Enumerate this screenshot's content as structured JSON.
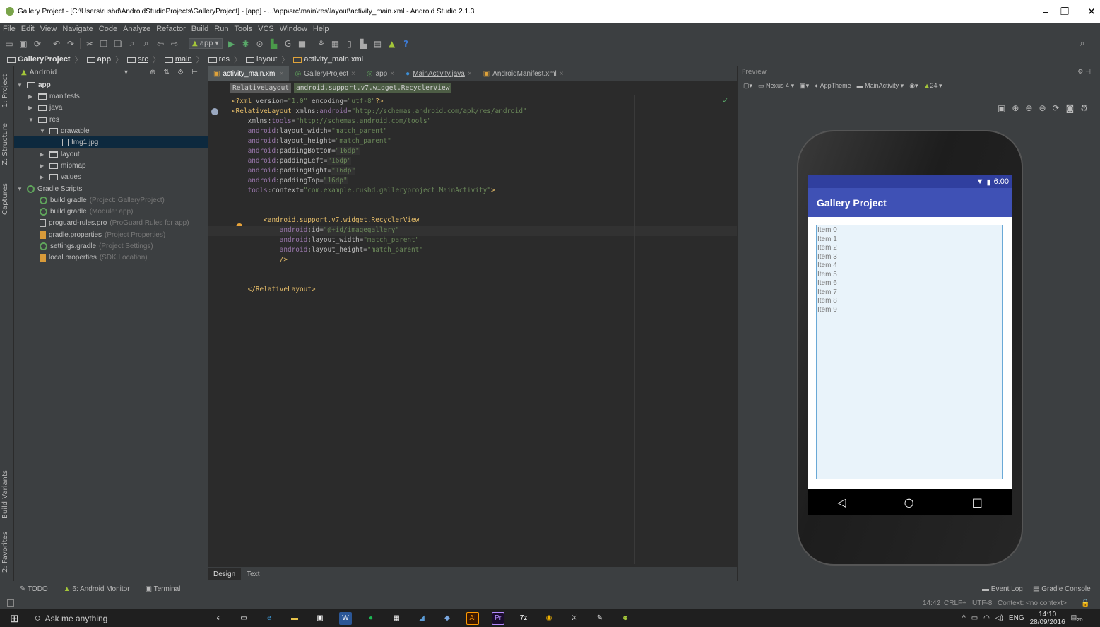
{
  "window": {
    "title": "Gallery Project - [C:\\Users\\rushd\\AndroidStudioProjects\\GalleryProject] - [app] - ...\\app\\src\\main\\res\\layout\\activity_main.xml - Android Studio 2.1.3",
    "min": "–",
    "max": "❐",
    "close": "✕"
  },
  "menu": [
    "File",
    "Edit",
    "View",
    "Navigate",
    "Code",
    "Analyze",
    "Refactor",
    "Build",
    "Run",
    "Tools",
    "VCS",
    "Window",
    "Help"
  ],
  "toolbar": {
    "config": "app",
    "help": "?"
  },
  "breadcrumb": [
    "GalleryProject",
    "app",
    "src",
    "main",
    "res",
    "layout",
    "activity_main.xml"
  ],
  "left_strip": {
    "project": "1: Project",
    "structure": "Z: Structure",
    "captures": "Captures",
    "build_variants": "Build Variants",
    "favorites": "2: Favorites"
  },
  "project_panel": {
    "view": "Android"
  },
  "tree": {
    "app": "app",
    "manifests": "manifests",
    "java": "java",
    "res": "res",
    "drawable": "drawable",
    "img": "Img1.jpg",
    "layout": "layout",
    "mipmap": "mipmap",
    "values": "values",
    "gradle_scripts": "Gradle Scripts",
    "files": [
      {
        "name": "build.gradle",
        "note": "(Project: GalleryProject)"
      },
      {
        "name": "build.gradle",
        "note": "(Module: app)"
      },
      {
        "name": "proguard-rules.pro",
        "note": "(ProGuard Rules for app)"
      },
      {
        "name": "gradle.properties",
        "note": "(Project Properties)"
      },
      {
        "name": "settings.gradle",
        "note": "(Project Settings)"
      },
      {
        "name": "local.properties",
        "note": "(SDK Location)"
      }
    ]
  },
  "editor_tabs": [
    {
      "label": "activity_main.xml",
      "close": "×"
    },
    {
      "label": "GalleryProject",
      "close": "×"
    },
    {
      "label": "app",
      "close": "×"
    },
    {
      "label": "MainActivity.java",
      "close": "×"
    },
    {
      "label": "AndroidManifest.xml",
      "close": "×"
    }
  ],
  "xml_path": [
    "RelativeLayout",
    "android.support.v7.widget.RecyclerView"
  ],
  "code": {
    "l1_a": "<?xml ",
    "l1_b": "version=",
    "l1_c": "\"1.0\"",
    "l1_d": " encoding=",
    "l1_e": "\"utf-8\"",
    "l1_f": "?>",
    "l2_a": "<RelativeLayout ",
    "l2_b": "xmlns:",
    "l2_c": "android",
    "l2_d": "=",
    "l2_e": "\"http://schemas.android.com/apk/res/android\"",
    "l3_a": "    xmlns:",
    "l3_b": "tools",
    "l3_c": "=",
    "l3_d": "\"http://schemas.android.com/tools\"",
    "l4_a": "    android",
    "l4_b": ":layout_width=",
    "l4_c": "\"match_parent\"",
    "l5_a": "    android",
    "l5_b": ":layout_height=",
    "l5_c": "\"match_parent\"",
    "l6_a": "    android",
    "l6_b": ":paddingBottom=",
    "l6_c": "\"16dp\"",
    "l7_a": "    android",
    "l7_b": ":paddingLeft=",
    "l7_c": "\"16dp\"",
    "l8_a": "    android",
    "l8_b": ":paddingRight=",
    "l8_c": "\"16dp\"",
    "l9_a": "    android",
    "l9_b": ":paddingTop=",
    "l9_c": "\"16dp\"",
    "l10_a": "    tools",
    "l10_b": ":context=",
    "l10_c": "\"com.example.rushd.galleryproject.MainActivity\"",
    "l10_d": ">",
    "l12_a": "        <android.support.v7.widget.RecyclerView",
    "l13_a": "            android",
    "l13_b": ":id=",
    "l13_c": "\"@+id/imagegallery\"",
    "l14_a": "            android",
    "l14_b": ":layout_width=",
    "l14_c": "\"match_parent\"",
    "l15_a": "            android",
    "l15_b": ":layout_height=",
    "l15_c": "\"match_parent\"",
    "l16_a": "            />",
    "l18_a": "    </RelativeLayout>"
  },
  "design_tabs": [
    "Design",
    "Text"
  ],
  "preview": {
    "title": "Preview",
    "device": "Nexus 4",
    "theme": "AppTheme",
    "activity": "MainActivity",
    "api": "24"
  },
  "phone": {
    "time": "6:00",
    "app_title": "Gallery Project",
    "items": [
      "Item 0",
      "Item 1",
      "Item 2",
      "Item 3",
      "Item 4",
      "Item 5",
      "Item 6",
      "Item 7",
      "Item 8",
      "Item 9"
    ],
    "back": "◁",
    "home": "○",
    "recents": "□"
  },
  "tool_windows": {
    "todo": "TODO",
    "monitor": "6: Android Monitor",
    "terminal": "Terminal",
    "event_log": "Event Log",
    "gradle_console": "Gradle Console"
  },
  "status": {
    "position": "14:42",
    "line_sep": "CRLF÷",
    "encoding": "UTF-8",
    "context": "Context: <no context>"
  },
  "taskbar": {
    "search": "Ask me anything",
    "lang": "ENG",
    "time": "14:10",
    "date": "28/09/2016",
    "notif": "20"
  }
}
